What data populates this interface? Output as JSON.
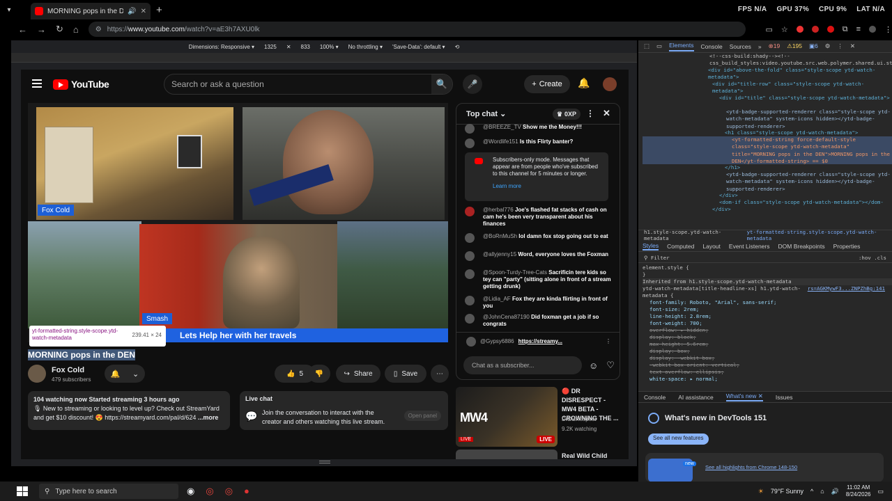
{
  "browser": {
    "tab_title": "MORNING pops in the DEN",
    "url_prefix": "https://",
    "url_domain": "www.youtube.com",
    "url_path": "/watch?v=aE3h7AXU0lk",
    "overlay": {
      "fps": "FPS N/A",
      "gpu": "GPU 37%",
      "cpu": "CPU 9%",
      "lat": "LAT N/A"
    }
  },
  "device_toolbar": {
    "dimensions_label": "Dimensions:",
    "mode": "Responsive",
    "width": "1325",
    "height": "833",
    "zoom": "100%",
    "throttle": "No throttling",
    "save_data": "'Save-Data': default"
  },
  "youtube": {
    "logo": "YouTube",
    "search_placeholder": "Search or ask a question",
    "create_label": "Create",
    "video": {
      "labels": {
        "cam1": "Fox Cold",
        "cam4": "Smash"
      },
      "banner": "Lets Help her with her travels",
      "tooltip_selector": "yt-formatted-string.style-scope.ytd-watch-metadata",
      "tooltip_size": "239.41 × 24",
      "title": "MORNING pops in the DEN"
    },
    "channel": {
      "name": "Fox Cold",
      "subs": "479 subscribers"
    },
    "actions": {
      "likes": "5",
      "share": "Share",
      "save": "Save"
    },
    "description": {
      "line1": "104 watching now  Started streaming 3 hours ago",
      "line2": "🎙 New to streaming or looking to level up? Check out StreamYard and get $10 discount! 😍 https://streamyard.com/pal/d/624",
      "more": "...more"
    },
    "live_chat_box": {
      "title": "Live chat",
      "text": "Join the conversation to interact with the creator and others watching this live stream.",
      "open": "Open panel"
    },
    "chat": {
      "header": "Top chat",
      "xp": "0XP",
      "messages": [
        {
          "author": "@BREEZE_TV",
          "text": "Show me the Money!!!"
        },
        {
          "author": "@Wordlife151",
          "text": "Is this Flirty banter?"
        },
        {
          "author": "@herbal776",
          "text": "Joe's flashed fat stacks of cash on cam he's been very transparent about his finances"
        },
        {
          "author": "@BoRnMuSh",
          "text": "lol damn fox stop going out to eat"
        },
        {
          "author": "@allyjenny15",
          "text": "Word, everyone loves the Foxman"
        },
        {
          "author": "@Spoon-Turdy-Tree-Cats",
          "text": "Sacrificin tere kids so tey can \"party\" (sitting alone in front of a stream getting drunk)"
        },
        {
          "author": "@Lidia_AF",
          "text": "Fox they are kinda flirting in front of you"
        },
        {
          "author": "@JohnCena87190",
          "text": "Did foxman get a job if so congrats"
        }
      ],
      "subscribers_notice": "Subscribers-only mode. Messages that appear are from people who've subscribed to this channel for 5 minutes or longer.",
      "learn_more": "Learn more",
      "pinned_author": "@Gypsy6886",
      "pinned_link": "https://streamy...",
      "input_placeholder": "Chat as a subscriber..."
    },
    "recommended": [
      {
        "title": "🔴 DR DISRESPECT - MW4 BETA - CROWNING THE ...",
        "channel": "DrDisRespect",
        "watching": "9.2K watching",
        "live": "LIVE",
        "live_small": "LIVE",
        "thumb_text": "MW4"
      },
      {
        "title": "Real Wild Child"
      }
    ]
  },
  "devtools": {
    "tabs": [
      "Elements",
      "Console",
      "Sources"
    ],
    "errors": "19",
    "warnings": "195",
    "infos": "6",
    "code_lines": [
      "<!--css-build:shady--><!--css_build_styles:video.youtube.src.web.polymer.shared.ui.styles.yt_base_styles.yt.base.styles.css.js-->",
      "<div id=\"above-the-fold\" class=\"style-scope ytd-watch-metadata\">",
      "<div id=\"title-row\" class=\"style-scope ytd-watch-metadata\">",
      "<div id=\"title\" class=\"style-scope ytd-watch-metadata\">",
      "<ytd-badge-supported-renderer class=\"style-scope ytd-watch-metadata\" system-icons hidden></ytd-badge-supported-renderer>",
      "<h1 class=\"style-scope ytd-watch-metadata\">",
      "<yt-formatted-string force-default-style class=\"style-scope ytd-watch-metadata\" title=\"MORNING pops in the DEN\">MORNING pops in the DEN</yt-formatted-string> == $0",
      "</h1>",
      "<ytd-badge-supported-renderer class=\"style-scope ytd-watch-metadata\" system-icons hidden></ytd-badge-supported-renderer>",
      "</div>",
      "<dom-if class=\"style-scope ytd-watch-metadata\"></dom-if>",
      "</div>"
    ],
    "crumb1": "h1.style-scope.ytd-watch-metadata",
    "crumb2": "yt-formatted-string.style-scope.ytd-watch-metadata",
    "style_tabs": [
      "Styles",
      "Computed",
      "Layout",
      "Event Listeners",
      "DOM Breakpoints",
      "Properties"
    ],
    "filter": "Filter",
    "filter_right": ":hov .cls",
    "styles": {
      "element_style": "element.style {",
      "inherited": "Inherited from h1.style-scope.ytd-watch-metadata",
      "rule": "ytd-watch-metadata[title-headline-xs] h1.ytd-watch-metadata {",
      "source": "rs=AGKMywF3...ZNPZhBg:141",
      "props": [
        "font-family: Roboto, \"Arial\", sans-serif;",
        "font-size: 2rem;",
        "line-height: 2.8rem;",
        "font-weight: 700;",
        "overflow: ▸ hidden;",
        "display: block;",
        "max-height: 5.6rem;",
        "display: box;",
        "display: -webkit-box;",
        "-webkit-box-orient: vertical;",
        "text-overflow: ellipsis;",
        "white-space: ▸ normal;"
      ]
    },
    "drawer_tabs": [
      "Console",
      "AI assistance",
      "What's new",
      "Issues"
    ],
    "whats_new": "What's new in DevTools 151",
    "see_all": "See all new features",
    "new_badge": "new",
    "highlights": "See all highlights from Chrome 148-150"
  },
  "taskbar": {
    "search_placeholder": "Type here to search",
    "weather": "79°F  Sunny",
    "time": "11:02 AM",
    "date": "8/24/2026"
  }
}
